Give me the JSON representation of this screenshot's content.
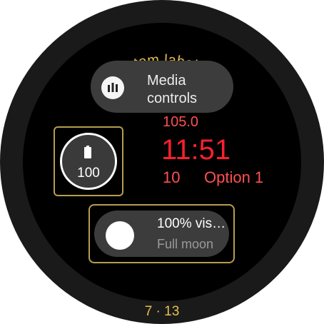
{
  "top_label": "Custom label :D",
  "bottom_label": "7 · 13",
  "media_chip": {
    "label_line1": "Media",
    "label_line2": "controls",
    "icon": "bar-chart-icon"
  },
  "battery_complication": {
    "value": "100",
    "icon": "battery-icon",
    "level": 1
  },
  "clock": {
    "small_value": "105.0",
    "time": "11:51",
    "left_value": "10",
    "right_value": "Option 1"
  },
  "moon_chip": {
    "title": "100% vis…",
    "subtitle": "Full moon",
    "icon": "moon-phase-icon"
  },
  "colors": {
    "accent": "#b79d4f",
    "clock_red": "#ff1f2d",
    "label_gold": "#e8c04c"
  }
}
